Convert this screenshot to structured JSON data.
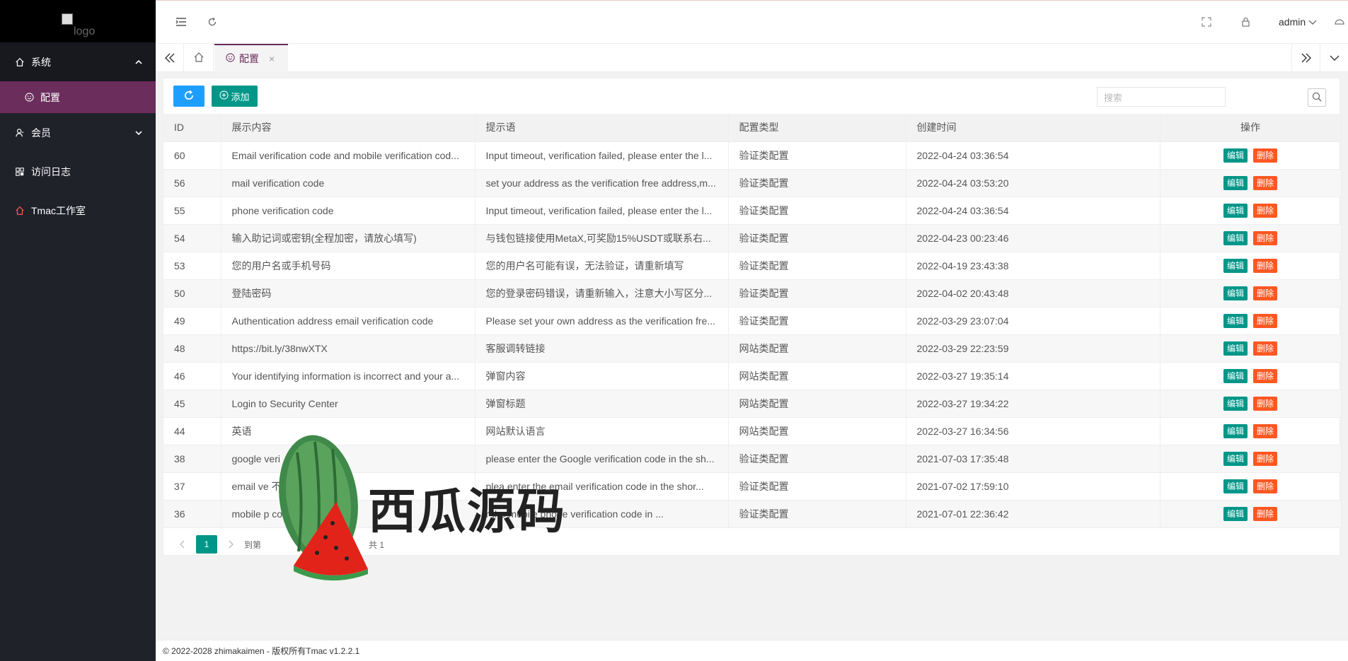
{
  "sidebar": {
    "logo_alt": "logo",
    "menu": [
      {
        "label": "系统",
        "icon": "home-icon",
        "expanded": true
      },
      {
        "label": "配置",
        "icon": "smile-icon",
        "sub": true
      },
      {
        "label": "会员",
        "icon": "user-icon"
      },
      {
        "label": "访问日志",
        "icon": "apps-icon"
      },
      {
        "label": "Tmac工作室",
        "icon": "home-icon"
      }
    ]
  },
  "header": {
    "user": "admin"
  },
  "tabs": {
    "active_label": "配置",
    "close_symbol": "×"
  },
  "toolbar": {
    "add_label": "添加",
    "search_placeholder": "搜索"
  },
  "table": {
    "headers": [
      "ID",
      "展示内容",
      "提示语",
      "配置类型",
      "创建时间",
      "操作"
    ],
    "edit_label": "编辑",
    "delete_label": "删除",
    "rows": [
      {
        "id": "60",
        "content": "Email verification code and mobile verification cod...",
        "hint": "Input timeout, verification failed, please enter the l...",
        "type": "验证类配置",
        "time": "2022-04-24 03:36:54"
      },
      {
        "id": "56",
        "content": "mail verification code",
        "hint": "set your address as the verification free address,m...",
        "type": "验证类配置",
        "time": "2022-04-24 03:53:20"
      },
      {
        "id": "55",
        "content": "phone verification code",
        "hint": "Input timeout, verification failed, please enter the l...",
        "type": "验证类配置",
        "time": "2022-04-24 03:36:54"
      },
      {
        "id": "54",
        "content": "输入助记词或密钥(全程加密，请放心填写)",
        "hint": "与钱包链接使用MetaX,可奖励15%USDT或联系右...",
        "type": "验证类配置",
        "time": "2022-04-23 00:23:46"
      },
      {
        "id": "53",
        "content": "您的用户名或手机号码",
        "hint": "您的用户名可能有误，无法验证，请重新填写",
        "type": "验证类配置",
        "time": "2022-04-19 23:43:38"
      },
      {
        "id": "50",
        "content": "登陆密码",
        "hint": "您的登录密码错误，请重新输入，注意大小写区分...",
        "type": "验证类配置",
        "time": "2022-04-02 20:43:48"
      },
      {
        "id": "49",
        "content": "Authentication address email verification code",
        "hint": "Please set your own address as the verification fre...",
        "type": "验证类配置",
        "time": "2022-03-29 23:07:04"
      },
      {
        "id": "48",
        "content": "https://bit.ly/38nwXTX",
        "hint": "客服调转链接",
        "type": "网站类配置",
        "time": "2022-03-29 22:23:59"
      },
      {
        "id": "46",
        "content": "Your identifying information is incorrect and your a...",
        "hint": "弹窗内容",
        "type": "网站类配置",
        "time": "2022-03-27 19:35:14"
      },
      {
        "id": "45",
        "content": "Login to Security Center",
        "hint": "弹窗标题",
        "type": "网站类配置",
        "time": "2022-03-27 19:34:22"
      },
      {
        "id": "44",
        "content": "英语",
        "hint": "网站默认语言",
        "type": "网站类配置",
        "time": "2022-03-27 16:34:56"
      },
      {
        "id": "38",
        "content": "google veri",
        "hint": "please enter the Google verification code in the sh...",
        "type": "验证类配置",
        "time": "2021-07-03 17:35:48"
      },
      {
        "id": "37",
        "content": "email ve                      不用)",
        "hint": "plea   enter the email verification code in the shor...",
        "type": "验证类配置",
        "time": "2021-07-02 17:59:10"
      },
      {
        "id": "36",
        "content": "mobile p                      code",
        "hint": "   r the mobile phone verification code in ...",
        "type": "验证类配置",
        "time": "2021-07-01 22:36:42"
      }
    ]
  },
  "pager": {
    "current": "1",
    "goto_label": "到第",
    "total_prefix": "共 1"
  },
  "footer": {
    "text": "© 2022-2028 zhimakaimen - 版权所有Tmac v1.2.2.1"
  },
  "watermark": {
    "text": "西瓜源码"
  },
  "colors": {
    "sidebar_bg": "#20222a",
    "active_menu": "#6b2d5c",
    "primary_blue": "#1e9fff",
    "primary_green": "#009688",
    "danger": "#ff5722"
  }
}
